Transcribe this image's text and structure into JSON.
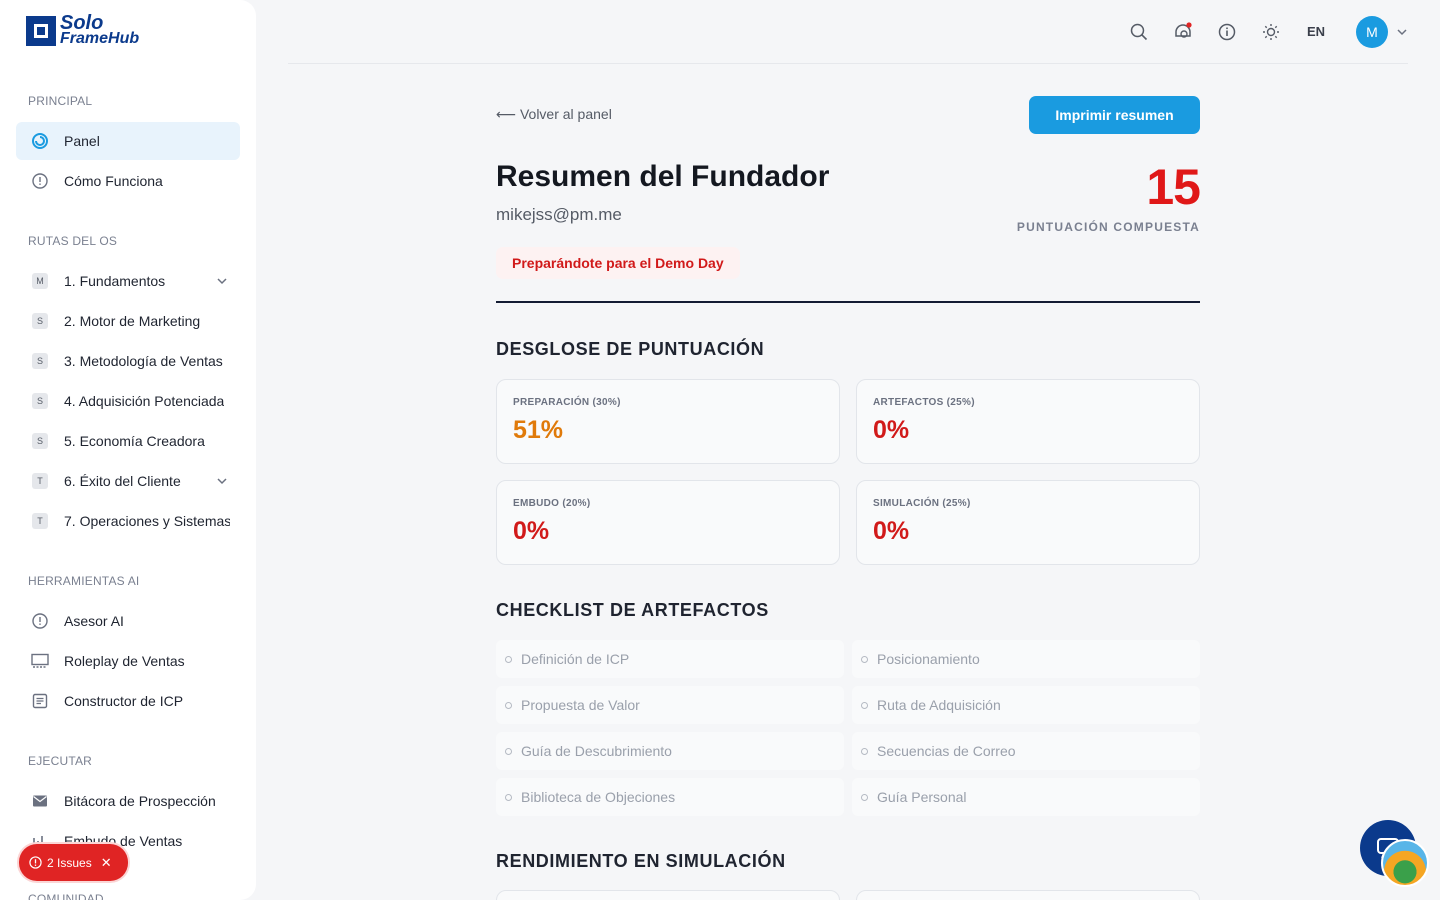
{
  "logo": {
    "line1": "Solo",
    "line2": "FrameHub"
  },
  "sidebar": {
    "sections": [
      {
        "label": "PRINCIPAL"
      },
      {
        "label": "RUTAS DEL OS"
      },
      {
        "label": "HERRAMIENTAS AI"
      },
      {
        "label": "EJECUTAR"
      },
      {
        "label": "COMUNIDAD"
      }
    ],
    "principal": [
      {
        "label": "Panel",
        "icon": "panel-icon"
      },
      {
        "label": "Cómo Funciona",
        "icon": "info-circle-icon"
      }
    ],
    "routes": [
      {
        "badge": "M",
        "label": "1. Fundamentos"
      },
      {
        "badge": "S",
        "label": "2. Motor de Marketing"
      },
      {
        "badge": "S",
        "label": "3. Metodología de Ventas"
      },
      {
        "badge": "S",
        "label": "4. Adquisición Potenciada"
      },
      {
        "badge": "S",
        "label": "5. Economía Creadora"
      },
      {
        "badge": "T",
        "label": "6. Éxito del Cliente"
      },
      {
        "badge": "T",
        "label": "7. Operaciones y Sistemas"
      }
    ],
    "tools": [
      {
        "label": "Asesor AI",
        "icon": "info-circle-icon"
      },
      {
        "label": "Roleplay de Ventas",
        "icon": "monitor-icon"
      },
      {
        "label": "Constructor de ICP",
        "icon": "document-icon"
      }
    ],
    "execute": [
      {
        "label": "Bitácora de Prospección",
        "icon": "mail-icon"
      },
      {
        "label": "Embudo de Ventas",
        "icon": "bar-chart-icon"
      }
    ]
  },
  "issues": {
    "label": "2 Issues"
  },
  "topbar": {
    "lang": "EN",
    "avatar_initial": "M"
  },
  "main": {
    "back_label": "Volver al panel",
    "print_label": "Imprimir resumen",
    "title": "Resumen del Fundador",
    "email": "mikejss@pm.me",
    "status": "Preparándote para el Demo Day",
    "score": "15",
    "score_label": "PUNTUACIÓN COMPUESTA",
    "breakdown_title": "DESGLOSE DE PUNTUACIÓN",
    "metrics": [
      {
        "label": "PREPARACIÓN (30%)",
        "value": "51%",
        "color": "#e07a0a"
      },
      {
        "label": "ARTEFACTOS (25%)",
        "value": "0%",
        "color": "#d11a1a"
      },
      {
        "label": "EMBUDO (20%)",
        "value": "0%",
        "color": "#d11a1a"
      },
      {
        "label": "SIMULACIÓN (25%)",
        "value": "0%",
        "color": "#d11a1a"
      }
    ],
    "checklist_title": "CHECKLIST DE ARTEFACTOS",
    "checklist": [
      "Definición de ICP",
      "Posicionamiento",
      "Propuesta de Valor",
      "Ruta de Adquisición",
      "Guía de Descubrimiento",
      "Secuencias de Correo",
      "Biblioteca de Objeciones",
      "Guía Personal"
    ],
    "simulation_title": "RENDIMIENTO EN SIMULACIÓN"
  }
}
